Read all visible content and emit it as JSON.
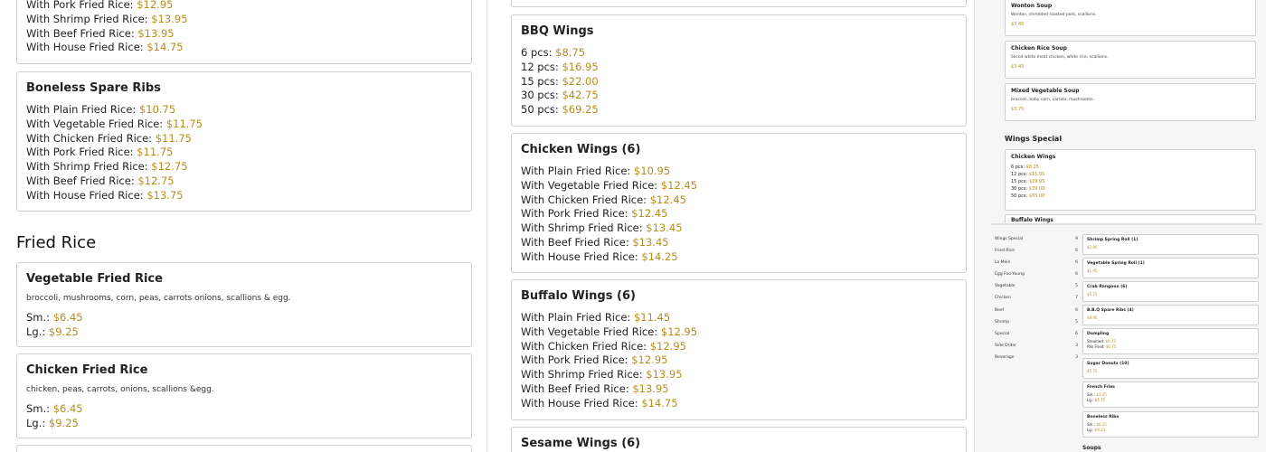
{
  "left": {
    "top_card": {
      "lines": [
        {
          "label": "With Pork Fried Rice:",
          "price": "$12.95"
        },
        {
          "label": "With Shrimp Fried Rice:",
          "price": "$13.95"
        },
        {
          "label": "With Beef Fried Rice:",
          "price": "$13.95"
        },
        {
          "label": "With House Fried Rice:",
          "price": "$14.75"
        }
      ]
    },
    "boneless": {
      "title": "Boneless Spare Ribs",
      "lines": [
        {
          "label": "With Plain Fried Rice:",
          "price": "$10.75"
        },
        {
          "label": "With Vegetable Fried Rice:",
          "price": "$11.75"
        },
        {
          "label": "With Chicken Fried Rice:",
          "price": "$11.75"
        },
        {
          "label": "With Pork Fried Rice:",
          "price": "$11.75"
        },
        {
          "label": "With Shrimp Fried Rice:",
          "price": "$12.75"
        },
        {
          "label": "With Beef Fried Rice:",
          "price": "$12.75"
        },
        {
          "label": "With House Fried Rice:",
          "price": "$13.75"
        }
      ]
    },
    "section_title": "Fried Rice",
    "veg_fried_rice": {
      "title": "Vegetable Fried Rice",
      "desc": "broccoli, mushrooms, corn, peas, carrots onions, scallions & egg.",
      "lines": [
        {
          "label": "Sm.:",
          "price": "$6.45"
        },
        {
          "label": "Lg.:",
          "price": "$9.25"
        }
      ]
    },
    "chicken_fried_rice": {
      "title": "Chicken Fried Rice",
      "desc": "chicken, peas, carrots, onions, scallions &egg.",
      "lines": [
        {
          "label": "Sm.:",
          "price": "$6.45"
        },
        {
          "label": "Lg.:",
          "price": "$9.25"
        }
      ]
    }
  },
  "mid": {
    "bbq": {
      "title": "BBQ Wings",
      "lines": [
        {
          "label": "6 pcs:",
          "price": "$8.75"
        },
        {
          "label": "12 pcs:",
          "price": "$16.95"
        },
        {
          "label": "15 pcs:",
          "price": "$22.00"
        },
        {
          "label": "30 pcs:",
          "price": "$42.75"
        },
        {
          "label": "50 pcs:",
          "price": "$69.25"
        }
      ]
    },
    "chicken_wings": {
      "title": "Chicken Wings (6)",
      "lines": [
        {
          "label": "With Plain Fried Rice:",
          "price": "$10.95"
        },
        {
          "label": "With Vegetable Fried Rice:",
          "price": "$12.45"
        },
        {
          "label": "With Chicken Fried Rice:",
          "price": "$12.45"
        },
        {
          "label": "With Pork Fried Rice:",
          "price": "$12.45"
        },
        {
          "label": "With Shrimp Fried Rice:",
          "price": "$13.45"
        },
        {
          "label": "With Beef Fried Rice:",
          "price": "$13.45"
        },
        {
          "label": "With House Fried Rice:",
          "price": "$14.25"
        }
      ]
    },
    "buffalo": {
      "title": "Buffalo Wings (6)",
      "lines": [
        {
          "label": "With Plain Fried Rice:",
          "price": "$11.45"
        },
        {
          "label": "With Vegetable Fried Rice:",
          "price": "$12.95"
        },
        {
          "label": "With Chicken Fried Rice:",
          "price": "$12.95"
        },
        {
          "label": "With Pork Fried Rice:",
          "price": "$12.95"
        },
        {
          "label": "With Shrimp Fried Rice:",
          "price": "$13.95"
        },
        {
          "label": "With Beef Fried Rice:",
          "price": "$13.95"
        },
        {
          "label": "With House Fried Rice:",
          "price": "$14.75"
        }
      ]
    },
    "sesame": {
      "title": "Sesame Wings (6)"
    }
  },
  "right": {
    "wonton": {
      "title": "Wonton Soup",
      "desc": "Wonton, shredded roasted pork, scallions.",
      "price": "$3.45"
    },
    "chicken_rice_soup": {
      "title": "Chicken Rice Soup",
      "desc": "Sliced white meat chicken, white rice, scallions.",
      "price": "$3.45"
    },
    "mixed_veg_soup": {
      "title": "Mixed Vegetable Soup",
      "desc": "broccoli, baby corn, carrots, mushrooms.",
      "price": "$3.75"
    },
    "wings_section": "Wings Special",
    "chicken_wings": {
      "title": "Chicken Wings",
      "lines": [
        {
          "label": "6 pcs:",
          "price": "$8.25"
        },
        {
          "label": "12 pcs:",
          "price": "$15.95"
        },
        {
          "label": "15 pcs:",
          "price": "$19.95"
        },
        {
          "label": "30 pcs:",
          "price": "$39.00"
        },
        {
          "label": "50 pcs:",
          "price": "$65.00"
        }
      ]
    },
    "buffalo_peek": "Buffalo Wings",
    "nav": [
      {
        "label": "Wings Special",
        "count": "9"
      },
      {
        "label": "Fried Rice",
        "count": "6"
      },
      {
        "label": "Lo Mein",
        "count": "6"
      },
      {
        "label": "Egg Foo Young",
        "count": "6"
      },
      {
        "label": "Vegetable",
        "count": "5"
      },
      {
        "label": "Chicken",
        "count": "7"
      },
      {
        "label": "Beef",
        "count": "6"
      },
      {
        "label": "Shrimp",
        "count": "5"
      },
      {
        "label": "Special",
        "count": "6"
      },
      {
        "label": "Side Order",
        "count": "3"
      },
      {
        "label": "Beverage",
        "count": "3"
      }
    ],
    "small_cards": [
      {
        "title": "Shrimp Spring Roll (1)",
        "lines": [
          {
            "label": "",
            "price": "$2.95"
          }
        ]
      },
      {
        "title": "Vegetable Spring Roll (1)",
        "lines": [
          {
            "label": "",
            "price": "$1.95"
          }
        ]
      },
      {
        "title": "Crab Rangoon (6)",
        "lines": [
          {
            "label": "",
            "price": "$5.75"
          }
        ]
      },
      {
        "title": "B.B.Q Spare Ribs (4)",
        "lines": [
          {
            "label": "",
            "price": "$9.95"
          }
        ]
      },
      {
        "title": "Dumpling",
        "lines": [
          {
            "label": "Steamed:",
            "price": "$6.75"
          },
          {
            "label": "Pan Fried:",
            "price": "$6.75"
          }
        ]
      },
      {
        "title": "Sugar Donuts (10)",
        "lines": [
          {
            "label": "",
            "price": "$5.75"
          }
        ]
      },
      {
        "title": "French Fries",
        "lines": [
          {
            "label": "Sm.:",
            "price": "$3.25"
          },
          {
            "label": "Lg.:",
            "price": "$4.75"
          }
        ]
      },
      {
        "title": "Boneless Ribs",
        "lines": [
          {
            "label": "Sm.:",
            "price": "$6.25"
          },
          {
            "label": "Lg.:",
            "price": "$9.25"
          }
        ]
      }
    ],
    "bottom_section": "Soups"
  }
}
